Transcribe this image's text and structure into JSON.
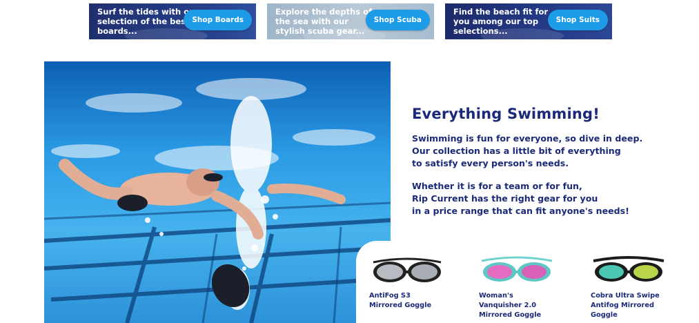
{
  "promos": [
    {
      "text_lines": [
        "Surf the tides with our",
        "selection of the best",
        "boards..."
      ],
      "button": "Shop Boards"
    },
    {
      "text_lines": [
        "Explore the depths of",
        "the sea with our",
        "stylish scuba gear..."
      ],
      "button": "Shop Scuba"
    },
    {
      "text_lines": [
        "Find the beach fit for",
        "you among our top",
        "selections..."
      ],
      "button": "Shop Suits"
    }
  ],
  "section": {
    "title": "Everything Swimming!",
    "paragraph1": [
      "Swimming is fun for everyone, so dive in deep.",
      "Our collection has a little bit of everything",
      "to satisfy every person's needs."
    ],
    "paragraph2": [
      "Whether it is for a team or for fun,",
      "Rip Current has the right gear for you",
      "in a price range that can fit anyone's needs!"
    ]
  },
  "products": [
    {
      "name_lines": [
        "AntiFog S3",
        "Mirrored Goggle"
      ],
      "icon": "goggle-black-mirrored-icon"
    },
    {
      "name_lines": [
        "Woman's",
        "Vanquisher 2.0",
        "Mirrored Goggle"
      ],
      "icon": "goggle-pink-mirrored-icon"
    },
    {
      "name_lines": [
        "Cobra Ultra Swipe",
        "Antifog Mirrored",
        "Goggle"
      ],
      "icon": "goggle-teal-mirrored-icon"
    }
  ],
  "colors": {
    "heading": "#1b2a78",
    "button": "#1e9be6",
    "promo_dark": "#1f2f6e",
    "promo_light": "#b9c8d6"
  }
}
